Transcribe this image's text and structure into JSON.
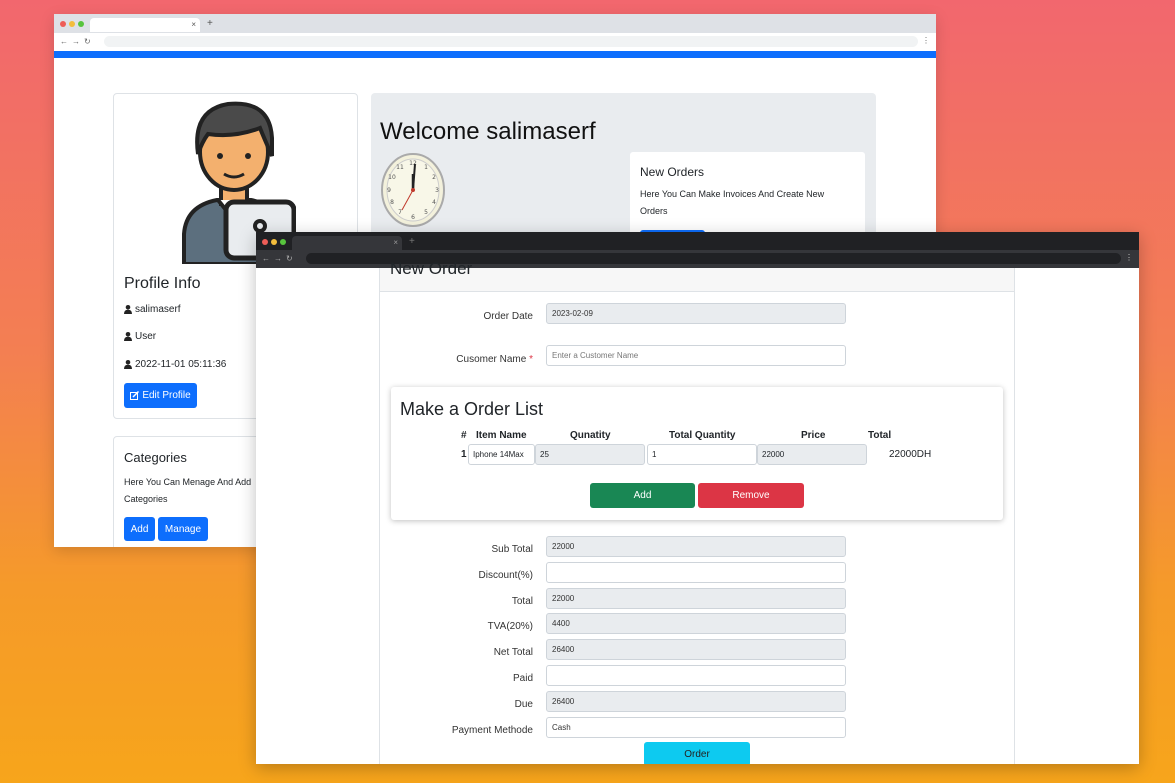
{
  "back_window": {
    "welcome": "Welcome salimaserf",
    "profile": {
      "title": "Profile Info",
      "username": "salimaserf",
      "role": "User",
      "date": "2022-11-01 05:11:36",
      "edit_button": "Edit Profile"
    },
    "categories": {
      "title": "Categories",
      "text": "Here You Can Menage And Add Categories",
      "add_button": "Add",
      "manage_button": "Manage"
    },
    "new_orders": {
      "title": "New Orders",
      "text": "Here You Can Make Invoices And Create New Orders"
    }
  },
  "front_window": {
    "card_title": "New Order",
    "order_date_label": "Order Date",
    "order_date_value": "2023-02-09",
    "customer_label": "Cusomer Name",
    "customer_required": "*",
    "customer_placeholder": "Enter a Customer Name",
    "list": {
      "title": "Make a Order List",
      "headers": [
        "#",
        "Item Name",
        "Qunatity",
        "Total Quantity",
        "Price",
        "Total"
      ],
      "rows": [
        {
          "num": "1",
          "item": "Iphone 14Max",
          "quantity": "25",
          "total_quantity": "1",
          "price": "22000",
          "total": "22000DH"
        }
      ],
      "add_button": "Add",
      "remove_button": "Remove"
    },
    "summary": {
      "sub_total_label": "Sub Total",
      "sub_total": "22000",
      "discount_label": "Discount(%)",
      "discount": "",
      "total_label": "Total",
      "total": "22000",
      "tva_label": "TVA(20%)",
      "tva": "4400",
      "net_total_label": "Net Total",
      "net_total": "26400",
      "paid_label": "Paid",
      "paid": "",
      "due_label": "Due",
      "due": "26400",
      "payment_label": "Payment Methode",
      "payment": "Cash"
    },
    "order_button": "Order"
  },
  "colors": {
    "primary": "#0d6efd",
    "success": "#198754",
    "danger": "#dc3545",
    "info": "#0dcaf0"
  }
}
